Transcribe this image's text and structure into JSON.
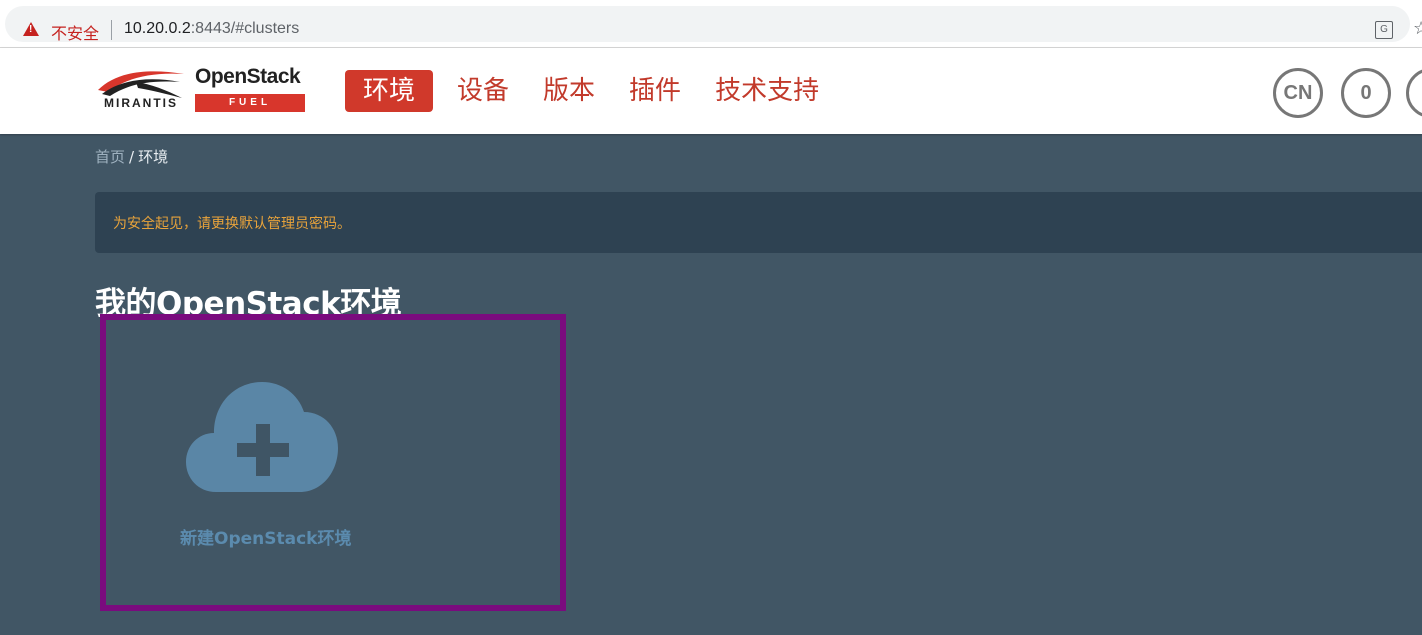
{
  "browser": {
    "security_label": "不安全",
    "url_host": "10.20.0.2",
    "url_rest": ":8443/#clusters"
  },
  "header": {
    "logo": {
      "brand": "MIRANTIS",
      "product": "OpenStack",
      "product_sub": "FUEL"
    },
    "nav": [
      {
        "label": "环境",
        "active": true
      },
      {
        "label": "设备",
        "active": false
      },
      {
        "label": "版本",
        "active": false
      },
      {
        "label": "插件",
        "active": false
      },
      {
        "label": "技术支持",
        "active": false
      }
    ],
    "language_button": "CN",
    "notifications_count": "0",
    "user_icon": "user-icon"
  },
  "breadcrumb": {
    "home": "首页",
    "separator": "/",
    "current": "环境"
  },
  "alert": {
    "text": "为安全起见，请更换默认管理员密码。"
  },
  "page": {
    "title": "我的OpenStack环境",
    "new_environment_label": "新建OpenStack环境"
  },
  "colors": {
    "accent": "#d0392b",
    "background": "#415665",
    "alert_text": "#e8a33b",
    "highlight_border": "#7a0b7e",
    "cloud": "#5a86a6"
  }
}
